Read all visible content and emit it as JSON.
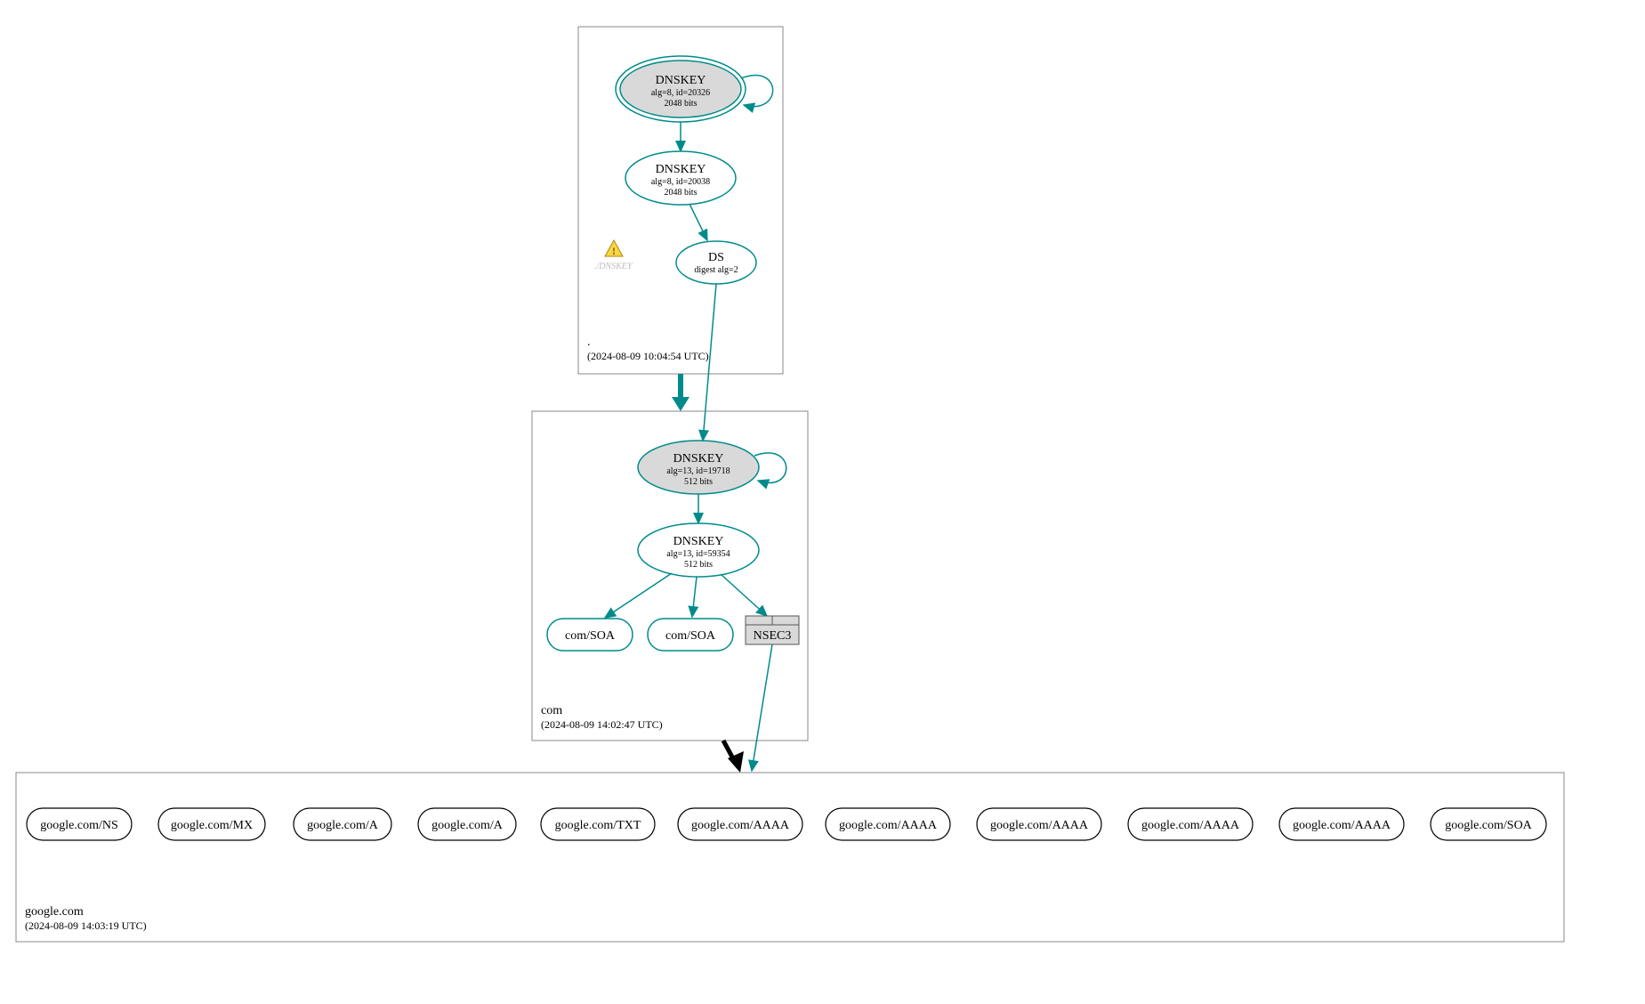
{
  "colors": {
    "teal": "#008b8b",
    "box_stroke": "#888888",
    "node_fill_grey": "#d9d9d9"
  },
  "zones": {
    "root": {
      "name": ".",
      "timestamp": "(2024-08-09 10:04:54 UTC)",
      "nodes": {
        "ksk": {
          "title": "DNSKEY",
          "line2": "alg=8, id=20326",
          "line3": "2048 bits"
        },
        "zsk": {
          "title": "DNSKEY",
          "line2": "alg=8, id=20038",
          "line3": "2048 bits"
        },
        "ds": {
          "title": "DS",
          "line2": "digest alg=2"
        },
        "warn": {
          "label": "./DNSKEY"
        }
      }
    },
    "com": {
      "name": "com",
      "timestamp": "(2024-08-09 14:02:47 UTC)",
      "nodes": {
        "ksk": {
          "title": "DNSKEY",
          "line2": "alg=13, id=19718",
          "line3": "512 bits"
        },
        "zsk": {
          "title": "DNSKEY",
          "line2": "alg=13, id=59354",
          "line3": "512 bits"
        },
        "soa1": {
          "label": "com/SOA"
        },
        "soa2": {
          "label": "com/SOA"
        },
        "nsec3": {
          "label": "NSEC3"
        }
      }
    },
    "google": {
      "name": "google.com",
      "timestamp": "(2024-08-09 14:03:19 UTC)",
      "records": [
        "google.com/NS",
        "google.com/MX",
        "google.com/A",
        "google.com/A",
        "google.com/TXT",
        "google.com/AAAA",
        "google.com/AAAA",
        "google.com/AAAA",
        "google.com/AAAA",
        "google.com/AAAA",
        "google.com/SOA"
      ]
    }
  }
}
